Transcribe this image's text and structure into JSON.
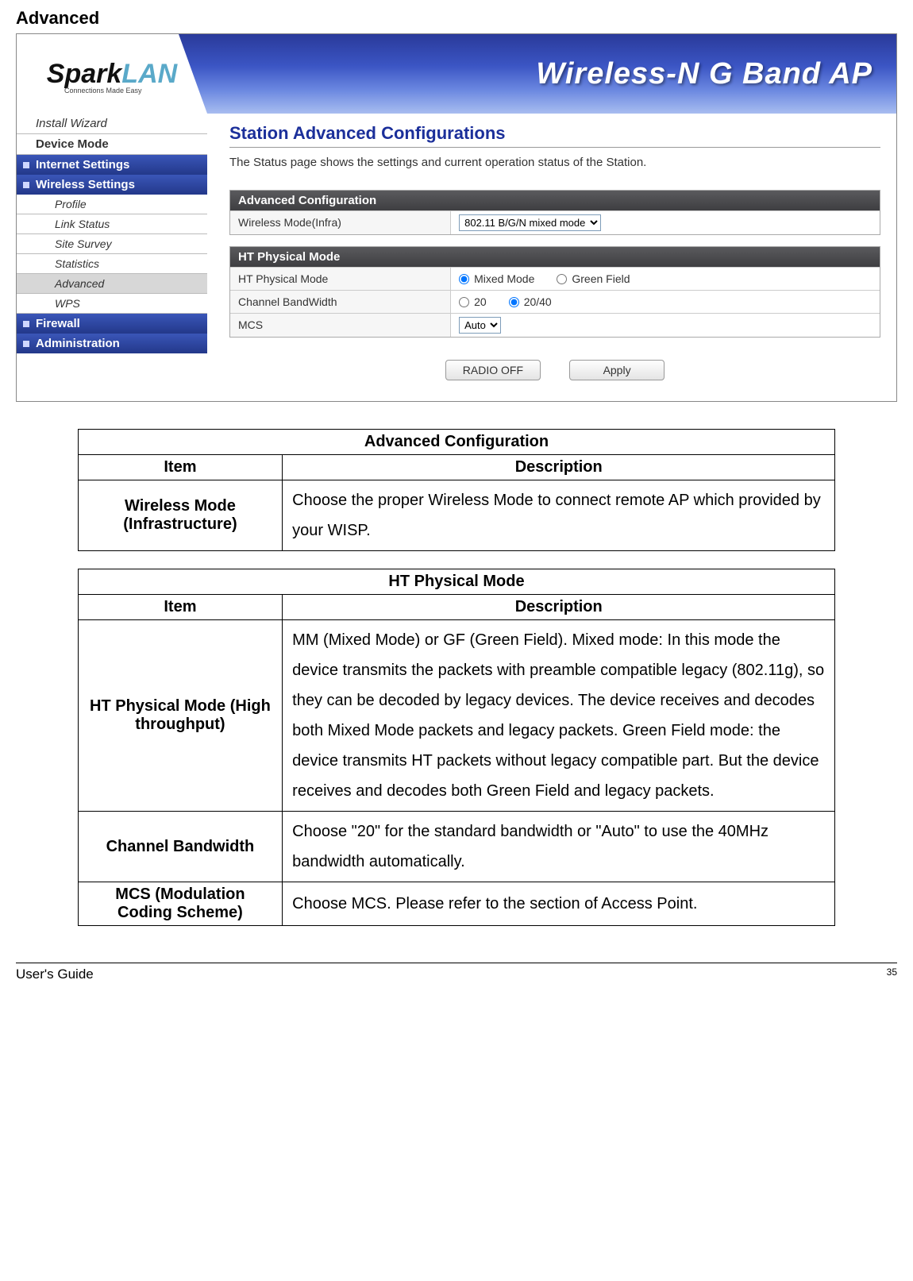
{
  "page_heading": "Advanced",
  "banner": {
    "logo_main": "Spark",
    "logo_suffix": "LAN",
    "logo_tagline": "Connections Made Easy",
    "title": "Wireless-N G Band AP"
  },
  "nav": {
    "items": [
      {
        "label": "Install Wizard",
        "type": "plain-italic"
      },
      {
        "label": "Device Mode",
        "type": "bold"
      },
      {
        "label": "Internet Settings",
        "type": "section"
      },
      {
        "label": "Wireless Settings",
        "type": "section"
      },
      {
        "label": "Profile",
        "type": "sub"
      },
      {
        "label": "Link Status",
        "type": "sub"
      },
      {
        "label": "Site Survey",
        "type": "sub"
      },
      {
        "label": "Statistics",
        "type": "sub"
      },
      {
        "label": "Advanced",
        "type": "sub-active"
      },
      {
        "label": "WPS",
        "type": "sub"
      },
      {
        "label": "Firewall",
        "type": "section"
      },
      {
        "label": "Administration",
        "type": "section"
      }
    ]
  },
  "main": {
    "title": "Station Advanced Configurations",
    "desc": "The Status page shows the settings and current operation status of the Station.",
    "panel1": {
      "head": "Advanced Configuration",
      "row1_label": "Wireless Mode(Infra)",
      "row1_select": "802.11 B/G/N mixed mode"
    },
    "panel2": {
      "head": "HT Physical Mode",
      "r1_label": "HT Physical Mode",
      "r1_opt1": "Mixed Mode",
      "r1_opt2": "Green Field",
      "r2_label": "Channel BandWidth",
      "r2_opt1": "20",
      "r2_opt2": "20/40",
      "r3_label": "MCS",
      "r3_select": "Auto"
    },
    "buttons": {
      "radio_off": "RADIO OFF",
      "apply": "Apply"
    }
  },
  "tables": {
    "t1": {
      "title": "Advanced Configuration",
      "col1": "Item",
      "col2": "Description",
      "rows": [
        {
          "item": "Wireless Mode (Infrastructure)",
          "desc": "Choose the proper Wireless Mode to connect remote AP which provided by your WISP."
        }
      ]
    },
    "t2": {
      "title": "HT Physical Mode",
      "col1": "Item",
      "col2": "Description",
      "rows": [
        {
          "item": "HT Physical Mode (High throughput)",
          "desc": "MM (Mixed Mode) or GF (Green Field).\nMixed mode: In this mode the device transmits the packets with preamble compatible legacy (802.11g), so they can be decoded by legacy devices. The device receives and decodes both Mixed Mode packets and legacy packets.\nGreen Field mode: the device transmits HT packets without legacy compatible part. But the device receives and decodes both Green Field and legacy packets."
        },
        {
          "item": "Channel Bandwidth",
          "desc": "Choose \"20\" for the standard bandwidth or \"Auto\" to use the 40MHz bandwidth automatically."
        },
        {
          "item": "MCS (Modulation Coding Scheme)",
          "desc": "Choose MCS. Please refer to the section of Access Point."
        }
      ]
    }
  },
  "footer": {
    "left": "User's Guide",
    "right": "35"
  }
}
